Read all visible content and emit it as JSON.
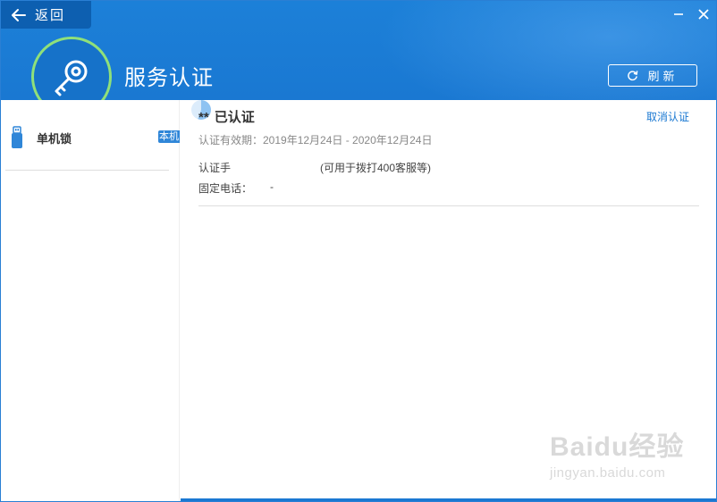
{
  "header": {
    "back_label": "返回",
    "title": "服务认证",
    "refresh_label": "刷新"
  },
  "sidebar": {
    "items": [
      {
        "label": "单机锁",
        "badge": "本机"
      }
    ]
  },
  "content": {
    "name": "**",
    "status": "已认证",
    "cancel_label": "取消认证",
    "validity": "认证有效期：2019年12月24日 - 2020年12月24日",
    "phone_label": "认证手",
    "phone_note": "(可用于拨打400客服等)",
    "fixed_phone_label": "固定电话：",
    "fixed_phone_value": "-"
  },
  "watermark": {
    "logo": "Baidu经验",
    "url": "jingyan.baidu.com"
  },
  "colors": {
    "header_bg": "#1a78d2",
    "accent_green": "#8fe07a",
    "link": "#1a78d2",
    "badge": "#2f86d8"
  }
}
